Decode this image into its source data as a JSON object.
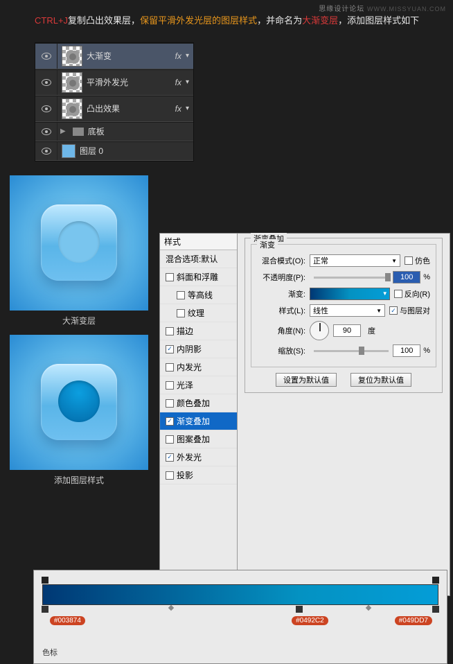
{
  "watermark": "思缘设计论坛",
  "watermark_url": "WWW.MISSYUAN.COM",
  "instr": {
    "kbd": "CTRL+J",
    "t1": "复制凸出效果层，",
    "keep": "保留平滑外发光层的图层样式",
    "t2": "，并命名为",
    "name": "大渐变层",
    "t3": "，添加图层样式如下"
  },
  "layers": [
    {
      "label": "大渐变",
      "fx": true,
      "selected": true,
      "thumb": "shape"
    },
    {
      "label": "平滑外发光",
      "fx": true,
      "selected": false,
      "thumb": "shape"
    },
    {
      "label": "凸出效果",
      "fx": true,
      "selected": false,
      "thumb": "shape"
    },
    {
      "label": "底板",
      "fx": false,
      "selected": false,
      "thumb": "folder"
    },
    {
      "label": "图层 0",
      "fx": false,
      "selected": false,
      "thumb": "solid"
    }
  ],
  "preview1_caption": "大渐变层",
  "preview2_caption": "添加图层样式",
  "dialog": {
    "styles_head": "样式",
    "blend_options": "混合选项:默认",
    "items": {
      "bevel": "斜面和浮雕",
      "contour": "等高线",
      "texture": "纹理",
      "stroke": "描边",
      "inner_shadow": "内阴影",
      "inner_glow": "内发光",
      "satin": "光泽",
      "color_ol": "颜色叠加",
      "grad_ol": "渐变叠加",
      "pattern_ol": "图案叠加",
      "outer_glow": "外发光",
      "drop_shadow": "投影"
    },
    "fieldset1": "渐变叠加",
    "fieldset2": "渐变",
    "labels": {
      "blend_mode": "混合模式(O):",
      "opacity": "不透明度(P):",
      "gradient": "渐变:",
      "style": "样式(L):",
      "angle": "角度(N):",
      "scale": "缩放(S):"
    },
    "values": {
      "blend_mode": "正常",
      "opacity": "100",
      "style": "线性",
      "angle": "90",
      "angle_unit": "度",
      "scale": "100"
    },
    "pct": "%",
    "chk_dither": "仿色",
    "chk_reverse": "反向(R)",
    "chk_align": "与图层对",
    "btn_default": "设置为默认值",
    "btn_reset": "复位为默认值"
  },
  "gradient": {
    "c1": "#003874",
    "c2": "#0492C2",
    "c3": "#049DD7",
    "stops_label": "色标"
  }
}
